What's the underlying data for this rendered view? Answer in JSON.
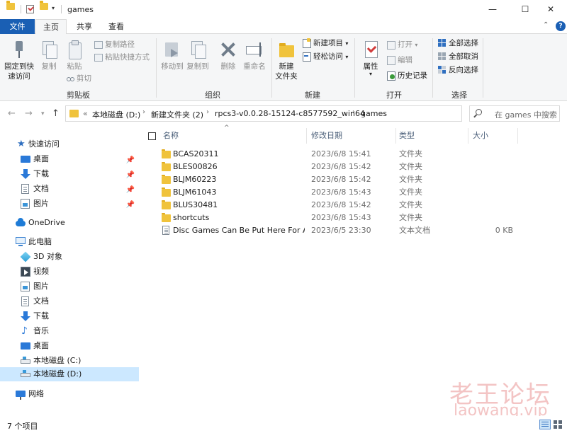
{
  "window": {
    "title": "games",
    "minimize": "—",
    "maximize": "☐",
    "close": "✕"
  },
  "tabs": {
    "file": "文件",
    "home": "主页",
    "share": "共享",
    "view": "查看"
  },
  "ribbon": {
    "clipboard": {
      "label": "剪贴板",
      "pin": "固定到快\n速访问",
      "copy": "复制",
      "paste": "粘贴",
      "copy_path": "复制路径",
      "paste_shortcut": "粘贴快捷方式",
      "cut": "剪切"
    },
    "organize": {
      "label": "组织",
      "move_to": "移动到",
      "copy_to": "复制到",
      "delete": "删除",
      "rename": "重命名"
    },
    "new": {
      "label": "新建",
      "new_folder": "新建\n文件夹",
      "new_item": "新建项目",
      "easy_access": "轻松访问"
    },
    "open": {
      "label": "打开",
      "properties": "属性",
      "open": "打开",
      "edit": "编辑",
      "history": "历史记录"
    },
    "select": {
      "label": "选择",
      "select_all": "全部选择",
      "select_none": "全部取消",
      "invert": "反向选择"
    }
  },
  "address": {
    "prefix": "«",
    "crumbs": [
      "本地磁盘 (D:)",
      "新建文件夹 (2)",
      "rpcs3-v0.0.28-15124-c8577592_win64",
      "games"
    ],
    "search_placeholder": "在 games 中搜索"
  },
  "nav": {
    "quick_access": "快速访问",
    "quick_items": [
      "桌面",
      "下载",
      "文档",
      "图片"
    ],
    "onedrive": "OneDrive",
    "this_pc": "此电脑",
    "pc_items": [
      "3D 对象",
      "视频",
      "图片",
      "文档",
      "下载",
      "音乐",
      "桌面",
      "本地磁盘 (C:)",
      "本地磁盘 (D:)"
    ],
    "network": "网络"
  },
  "columns": {
    "name": "名称",
    "date": "修改日期",
    "type": "类型",
    "size": "大小"
  },
  "files": [
    {
      "name": "BCAS20311",
      "date": "2023/6/8 15:41",
      "type": "文件夹",
      "size": "",
      "icon": "folder-icon"
    },
    {
      "name": "BLES00826",
      "date": "2023/6/8 15:42",
      "type": "文件夹",
      "size": "",
      "icon": "folder-icon"
    },
    {
      "name": "BLJM60223",
      "date": "2023/6/8 15:42",
      "type": "文件夹",
      "size": "",
      "icon": "folder-icon"
    },
    {
      "name": "BLJM61043",
      "date": "2023/6/8 15:43",
      "type": "文件夹",
      "size": "",
      "icon": "folder-icon"
    },
    {
      "name": "BLUS30481",
      "date": "2023/6/8 15:42",
      "type": "文件夹",
      "size": "",
      "icon": "folder-icon"
    },
    {
      "name": "shortcuts",
      "date": "2023/6/8 15:43",
      "type": "文件夹",
      "size": "",
      "icon": "folder-icon"
    },
    {
      "name": "Disc Games Can Be Put Here For A...",
      "date": "2023/6/5 23:30",
      "type": "文本文档",
      "size": "0 KB",
      "icon": "text-file-icon"
    }
  ],
  "status": {
    "item_count": "7 个项目"
  },
  "watermark": {
    "cn": "老王论坛",
    "en": "laowang.vip"
  },
  "colors": {
    "accent": "#1a5fb4",
    "folder": "#f0c33c",
    "selected": "#cce8ff",
    "watermark": "#f3c4c4"
  }
}
